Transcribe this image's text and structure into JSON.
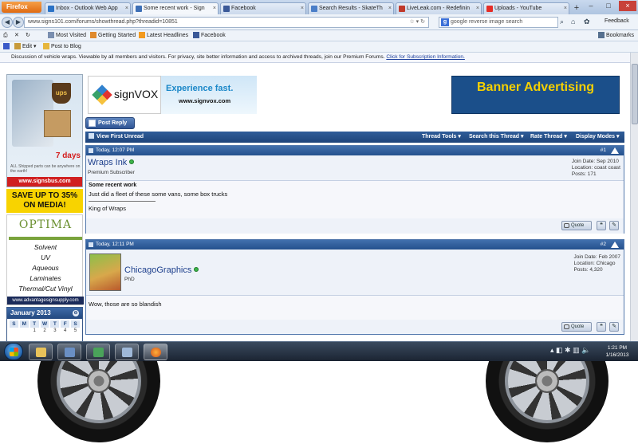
{
  "browser": {
    "menu_label": "Firefox",
    "tabs": [
      {
        "title": "Inbox - Outlook Web App",
        "color": "#2a72c6",
        "active": false
      },
      {
        "title": "Some recent work - Sign",
        "color": "#3d6fb6",
        "active": true
      },
      {
        "title": "Facebook",
        "color": "#3b5998",
        "active": false
      },
      {
        "title": "Search Results - SkateTh",
        "color": "#4a7ec8",
        "active": false
      },
      {
        "title": "LiveLeak.com - Redefinin",
        "color": "#c0392b",
        "active": false
      },
      {
        "title": "Uploads - YouTube",
        "color": "#e52d27",
        "active": false
      }
    ],
    "new_tab": "+",
    "url": "www.signs101.com/forums/showthread.php?threadid=10851",
    "search_text": "google reverse image search",
    "feedback_label": "Feedback",
    "bookmarks_label": "Bookmarks",
    "bookmarks_bar": [
      "Most Visited",
      "Getting Started",
      "Latest Headlines",
      "Facebook"
    ],
    "addon_bar": [
      "Edit",
      "Post to Blog"
    ]
  },
  "page": {
    "notice_text": "Discussion of vehicle wraps. Viewable by all members and visitors. For privacy, site better information and access to archived threads, join our Premium Forums.",
    "notice_link": "Click for Subscription Information.",
    "ads": {
      "ups_label": "ups",
      "days_label": "7 days",
      "small_text": "ALL Shipped parts can be anywhere on the earth!",
      "signsbus_label": "www.signsbus.com",
      "save_label": "SAVE UP TO 35% ON MEDIA!",
      "optima_label": "OPTIMA",
      "optima_items": [
        "Solvent",
        "UV",
        "Aqueous",
        "Laminates",
        "Thermal/Cut Vinyl"
      ],
      "optima_web": "www.advantagesignsupply.com",
      "signvox_name": "signVOX",
      "signvox_tag": "Experience fast.",
      "signvox_site": "www.signvox.com",
      "banner_text": "Banner Advertising"
    },
    "calendar": {
      "month": "January 2013",
      "days": [
        "S",
        "M",
        "T",
        "W",
        "T",
        "F",
        "S"
      ],
      "first_row": [
        "",
        "",
        "1",
        "2",
        "3",
        "4",
        "5"
      ]
    },
    "post_reply": "Post Reply",
    "thread_bar": {
      "view_first_unread": "View First Unread",
      "thread_tools": "Thread Tools",
      "search_thread": "Search this Thread",
      "rate_thread": "Rate Thread",
      "display_modes": "Display Modes"
    },
    "posts": [
      {
        "date": "Today, 12:07 PM",
        "number": "#1",
        "username": "Wraps Ink",
        "user_title": "Premium Subscriber",
        "stats": [
          "Join Date: Sep 2010",
          "Location: coast coast",
          "Posts: 171"
        ],
        "title": "Some recent work",
        "body": "Just did a fleet of these some vans, some box trucks",
        "signature": "King of Wraps",
        "quote_label": "Quote"
      },
      {
        "date": "Today, 12:11 PM",
        "number": "#2",
        "username": "ChicagoGraphics",
        "user_title": "PhD",
        "stats": [
          "Join Date: Feb 2007",
          "Location: Chicago",
          "Posts: 4,320"
        ],
        "body": "Wow, those are so blandish",
        "quote_label": "Quote"
      }
    ]
  },
  "taskbar": {
    "clock_time": "1:21 PM",
    "clock_date": "1/16/2013"
  }
}
